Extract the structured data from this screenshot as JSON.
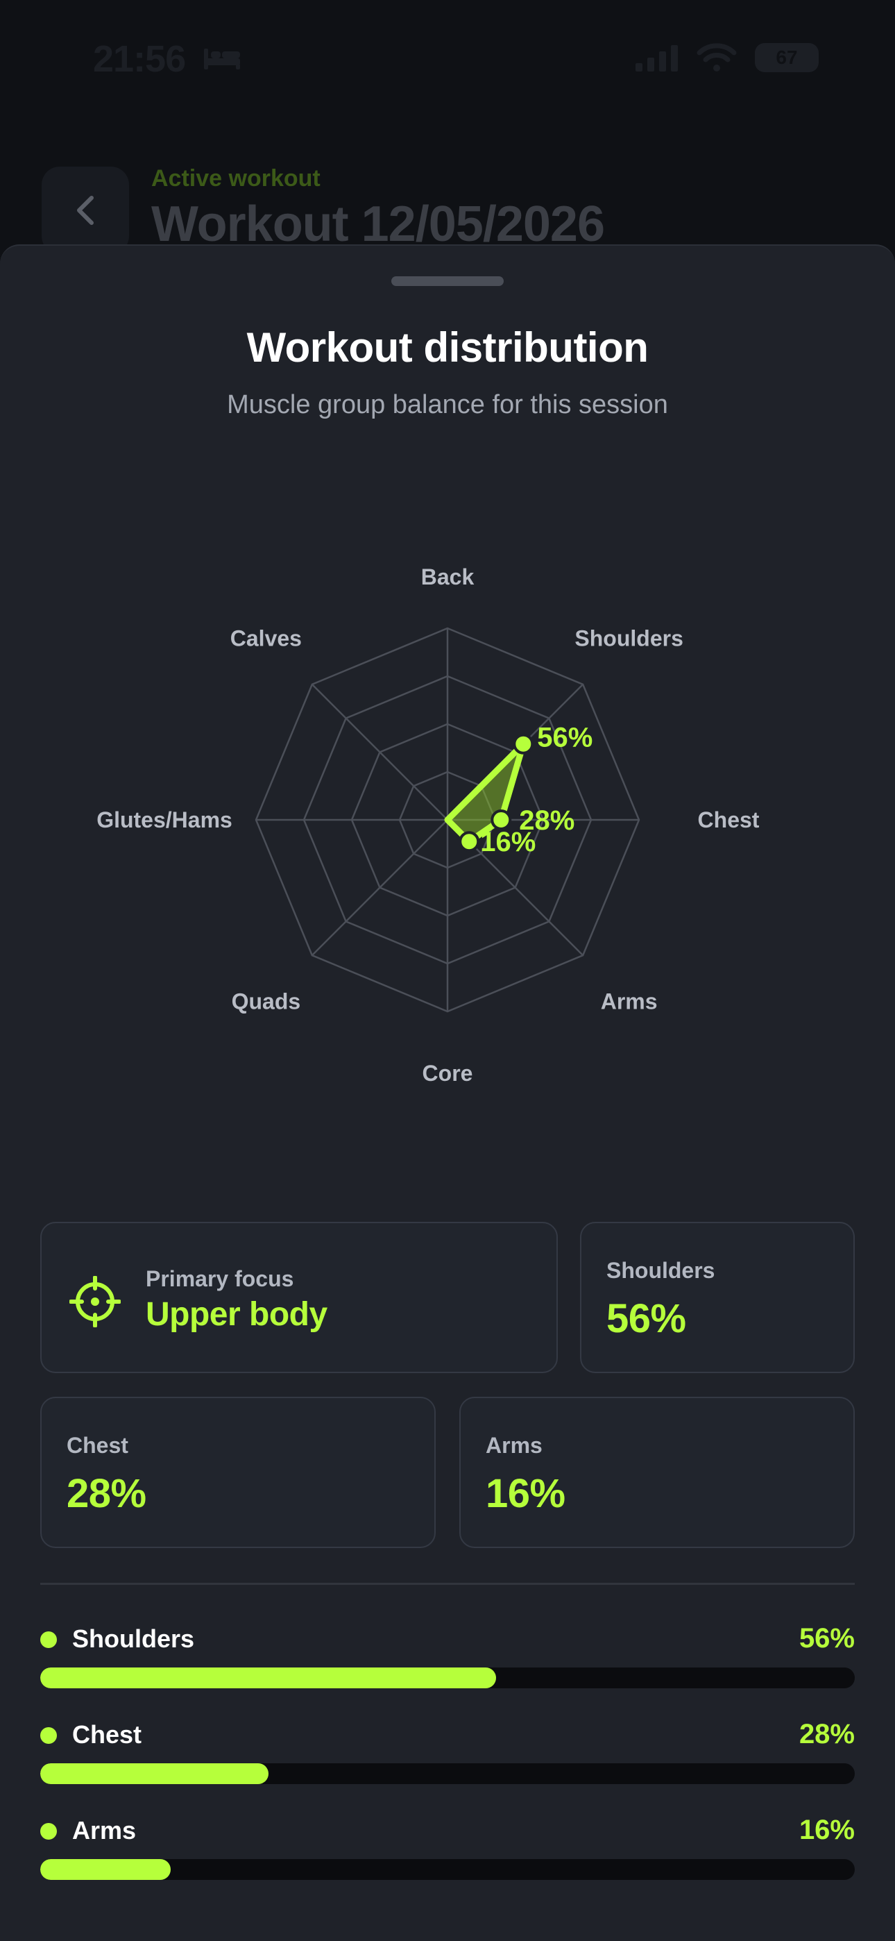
{
  "status_bar": {
    "time": "21:56",
    "battery": "67"
  },
  "background_header": {
    "kicker": "Active workout",
    "title": "Workout 12/05/2026"
  },
  "sheet": {
    "title": "Workout distribution",
    "subtitle": "Muscle group balance for this session"
  },
  "chart_data": {
    "type": "radar",
    "axes": [
      "Back",
      "Shoulders",
      "Chest",
      "Arms",
      "Core",
      "Quads",
      "Glutes/Hams",
      "Calves"
    ],
    "values": [
      0,
      56,
      28,
      16,
      0,
      0,
      0,
      0
    ],
    "value_labels": [
      "",
      "56%",
      "28%",
      "16%",
      "",
      "",
      "",
      ""
    ],
    "range": [
      0,
      100
    ],
    "rings": 4,
    "grid": true,
    "color": "#b6ff3b"
  },
  "cards": {
    "primary_focus": {
      "label": "Primary focus",
      "value": "Upper body"
    },
    "shoulders": {
      "label": "Shoulders",
      "value": "56%"
    },
    "chest": {
      "label": "Chest",
      "value": "28%"
    },
    "arms": {
      "label": "Arms",
      "value": "16%"
    }
  },
  "bars": [
    {
      "label": "Shoulders",
      "value_text": "56%",
      "value": 56
    },
    {
      "label": "Chest",
      "value_text": "28%",
      "value": 28
    },
    {
      "label": "Arms",
      "value_text": "16%",
      "value": 16
    }
  ],
  "colors": {
    "accent": "#b6ff3b",
    "sheet_bg": "#1f2229",
    "card_bg": "#21252d"
  },
  "icons": {
    "back": "chevron-left-icon",
    "focus": "crosshair-icon",
    "wifi": "wifi-icon",
    "signal": "signal-icon",
    "sleep": "bed-icon"
  }
}
